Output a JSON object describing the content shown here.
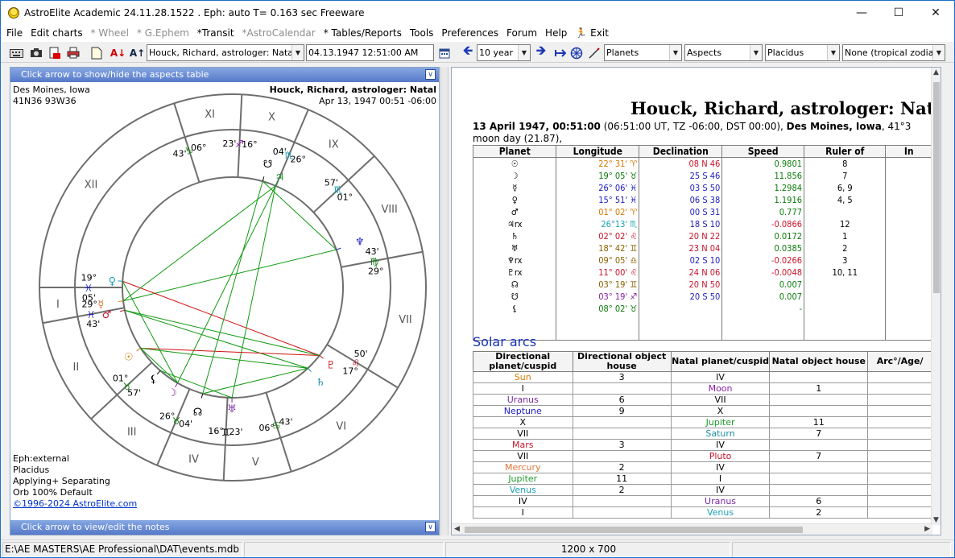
{
  "window": {
    "title": "AstroElite Academic 24.11.28.1522 . Eph: auto T= 0.163 sec Freeware"
  },
  "menu": [
    {
      "label": "File",
      "enabled": true
    },
    {
      "label": "Edit charts",
      "enabled": true
    },
    {
      "label": "* Wheel",
      "enabled": false
    },
    {
      "label": "* G.Ephem",
      "enabled": false
    },
    {
      "label": "*Transit",
      "enabled": true
    },
    {
      "label": "*AstroCalendar",
      "enabled": false
    },
    {
      "label": "* Tables/Reports",
      "enabled": true
    },
    {
      "label": "Tools",
      "enabled": true
    },
    {
      "label": "Preferences",
      "enabled": true
    },
    {
      "label": "Forum",
      "enabled": true
    },
    {
      "label": "Help",
      "enabled": true
    },
    {
      "label": "Exit",
      "enabled": true,
      "icon": "running-man-icon"
    }
  ],
  "toolbar": {
    "chart_name": "Houck, Richard, astrologer: Nata",
    "datetime": "04.13.1947   12:51:00 AM",
    "step": "10 year",
    "planets": "Planets",
    "aspects": "Aspects",
    "house_system": "Placidus",
    "zodiac": "None (tropical zodiac)"
  },
  "left": {
    "top_bar": "Click arrow to show/hide the aspects table",
    "bottom_bar": "Click arrow to view/edit the notes",
    "location": "Des Moines, Iowa",
    "coords": "41N36 93W36",
    "chart_title": "Houck, Richard, astrologer: Natal",
    "chart_date": "Apr 13, 1947 00:51 -06:00",
    "eph": "Eph:external",
    "house": "Placidus",
    "applying": "Applying+ Separating",
    "orb": "Orb 100% Default",
    "copyright": "©1996-2024 AstroElite.com"
  },
  "wheel": {
    "houses": [
      {
        "numeral": "I",
        "cusp_deg": 19,
        "cusp_min": "05'",
        "sign": "Pisces"
      },
      {
        "numeral": "II",
        "cusp_deg": 29,
        "cusp_min": "43'",
        "sign": "Pisces"
      },
      {
        "numeral": "III",
        "cusp_deg": 1,
        "cusp_min": "57'",
        "sign": "Taurus"
      },
      {
        "numeral": "IV",
        "cusp_deg": 26,
        "cusp_min": "04'",
        "sign": "Taurus"
      },
      {
        "numeral": "V",
        "cusp_deg": 16,
        "cusp_min": "23'",
        "sign": "Gemini"
      },
      {
        "numeral": "VI",
        "cusp_deg": 6,
        "cusp_min": "43'",
        "sign": "Cancer"
      },
      {
        "numeral": "VII",
        "cusp_deg": 17,
        "cusp_min": "50'",
        "sign": "Leo"
      },
      {
        "numeral": "VIII",
        "cusp_deg": 29,
        "cusp_min": "43'",
        "sign": "Virgo"
      },
      {
        "numeral": "IX",
        "cusp_deg": 1,
        "cusp_min": "57'",
        "sign": "Scorpio"
      },
      {
        "numeral": "X",
        "cusp_deg": 26,
        "cusp_min": "04'",
        "sign": "Scorpio"
      },
      {
        "numeral": "XI",
        "cusp_deg": 16,
        "cusp_min": "23'",
        "sign": "Sagittarius"
      },
      {
        "numeral": "XII",
        "cusp_deg": 6,
        "cusp_min": "43'",
        "sign": "Capricorn"
      }
    ],
    "planets": [
      {
        "name": "Sun",
        "glyph": "☉",
        "deg": "22°",
        "min": "31'",
        "sign": "Aries",
        "color": "#d67a00"
      },
      {
        "name": "Moon",
        "glyph": "☽",
        "deg": "19°",
        "min": "05'",
        "sign": "Taurus",
        "color": "#8a1fa6"
      },
      {
        "name": "Mercury",
        "glyph": "☿",
        "deg": "26°",
        "min": "06'",
        "sign": "Pisces",
        "color": "#e0743a"
      },
      {
        "name": "Venus",
        "glyph": "♀",
        "deg": "15°",
        "min": "51'",
        "sign": "Pisces",
        "color": "#1aa0b5"
      },
      {
        "name": "Mars",
        "glyph": "♂",
        "deg": "01°",
        "min": "02'",
        "sign": "Aries",
        "color": "#c8142a"
      },
      {
        "name": "Jupiter",
        "glyph": "♃",
        "deg": "26°",
        "min": "13'",
        "sign": "Scorpio",
        "color": "#1b9a2a"
      },
      {
        "name": "Saturn",
        "glyph": "♄",
        "deg": "02°",
        "min": "02'",
        "sign": "Leo",
        "color": "#1f8ea8"
      },
      {
        "name": "Uranus",
        "glyph": "♅",
        "deg": "18°",
        "min": "42'",
        "sign": "Gemini",
        "color": "#7a2aa8"
      },
      {
        "name": "Neptune",
        "glyph": "♆",
        "deg": "09°",
        "min": "05'",
        "sign": "Libra",
        "color": "#2020c0"
      },
      {
        "name": "Pluto",
        "glyph": "♇",
        "deg": "11°",
        "min": "00'",
        "sign": "Leo",
        "color": "#c81e1e"
      },
      {
        "name": "Node",
        "glyph": "☊",
        "deg": "03°",
        "min": "19'",
        "sign": "Gemini",
        "color": "#000"
      },
      {
        "name": "South Node",
        "glyph": "☋",
        "deg": "03°",
        "min": "19'",
        "sign": "Sagittarius",
        "color": "#000"
      },
      {
        "name": "Lilith",
        "glyph": "⚸",
        "deg": "08°",
        "min": "02'",
        "sign": "Taurus",
        "color": "#000"
      }
    ],
    "colors": {
      "green": "#119911",
      "red": "#cc1111",
      "ring": "#6e6e6e"
    }
  },
  "report": {
    "title": "Houck, Richard, astrologer: Natal",
    "date_bold": "13 April 1947, 00:51:00",
    "date_rest": "  (06:51:00 UT, TZ -06:00, DST  00:00), ",
    "place_bold": "Des Moines, Iowa",
    "place_rest": ", 41°3",
    "moon_day": "moon day (21.87),",
    "planet_headers": [
      "Planet",
      "Longitude",
      "Declination",
      "Speed",
      "Ruler of",
      "In"
    ],
    "planet_rows": [
      {
        "glyph": "☉",
        "rx": "",
        "lon": "22° 31' ♈",
        "lon_color": "#d67a00",
        "dec": "08 N 46",
        "dec_color": "#c8142a",
        "speed": "0.9801",
        "speed_color": "#0a7a0a",
        "ruler": "8"
      },
      {
        "glyph": "☽",
        "rx": "",
        "lon": "19° 05' ♉",
        "lon_color": "#0a7a0a",
        "dec": "25 S 46",
        "dec_color": "#2020c0",
        "speed": "11.856",
        "speed_color": "#0a7a0a",
        "ruler": "7"
      },
      {
        "glyph": "☿",
        "rx": "",
        "lon": "26° 06' ♓",
        "lon_color": "#2020c0",
        "dec": "03 S 50",
        "dec_color": "#2020c0",
        "speed": "1.2984",
        "speed_color": "#0a7a0a",
        "ruler": "6, 9"
      },
      {
        "glyph": "♀",
        "rx": "",
        "lon": "15° 51' ♓",
        "lon_color": "#2020c0",
        "dec": "06 S 38",
        "dec_color": "#2020c0",
        "speed": "1.1916",
        "speed_color": "#0a7a0a",
        "ruler": "4, 5"
      },
      {
        "glyph": "♂",
        "rx": "",
        "lon": "01° 02' ♈",
        "lon_color": "#d67a00",
        "dec": "00 S 31",
        "dec_color": "#2020c0",
        "speed": "0.777",
        "speed_color": "#0a7a0a",
        "ruler": ""
      },
      {
        "glyph": "♃",
        "rx": "rx",
        "lon": "26°13' ♏",
        "lon_color": "#1aa0b5",
        "dec": "18 S 10",
        "dec_color": "#2020c0",
        "speed": "-0.0866",
        "speed_color": "#c8142a",
        "ruler": "12"
      },
      {
        "glyph": "♄",
        "rx": "",
        "lon": "02° 02' ♌",
        "lon_color": "#c8142a",
        "dec": "20 N 22",
        "dec_color": "#c8142a",
        "speed": "0.0172",
        "speed_color": "#0a7a0a",
        "ruler": "1"
      },
      {
        "glyph": "♅",
        "rx": "",
        "lon": "18° 42' ♊",
        "lon_color": "#8a6000",
        "dec": "23 N 04",
        "dec_color": "#c8142a",
        "speed": "0.0385",
        "speed_color": "#0a7a0a",
        "ruler": "2"
      },
      {
        "glyph": "♆",
        "rx": "rx",
        "lon": "09° 05' ♎",
        "lon_color": "#8a6000",
        "dec": "02 S 10",
        "dec_color": "#2020c0",
        "speed": "-0.0266",
        "speed_color": "#c8142a",
        "ruler": "3"
      },
      {
        "glyph": "♇",
        "rx": "rx",
        "lon": "11° 00' ♌",
        "lon_color": "#c8142a",
        "dec": "24 N 06",
        "dec_color": "#c8142a",
        "speed": "-0.0048",
        "speed_color": "#c8142a",
        "ruler": "10, 11"
      },
      {
        "glyph": "☊",
        "rx": "",
        "lon": "03° 19' ♊",
        "lon_color": "#8a6000",
        "dec": "20 N 50",
        "dec_color": "#c8142a",
        "speed": "0.007",
        "speed_color": "#0a7a0a",
        "ruler": ""
      },
      {
        "glyph": "☋",
        "rx": "",
        "lon": "03° 19' ♐",
        "lon_color": "#8a1fa6",
        "dec": "20 S 50",
        "dec_color": "#2020c0",
        "speed": "0.007",
        "speed_color": "#0a7a0a",
        "ruler": ""
      },
      {
        "glyph": "⚸",
        "rx": "",
        "lon": "08° 02' ♉",
        "lon_color": "#0a7a0a",
        "dec": "",
        "dec_color": "#000",
        "speed": "-",
        "speed_color": "#0a7a0a",
        "ruler": ""
      }
    ],
    "solar_arcs_heading": "Solar arcs",
    "solar_headers": [
      "Directional planet/cuspid",
      "Directional object house",
      "Natal planet/cuspid",
      "Natal object house",
      "Arc°/Age/"
    ],
    "solar_rows": [
      {
        "dir": "Sun",
        "dir_color": "#d67a00",
        "dir_house": "3",
        "natal": "IV",
        "natal_color": "#000",
        "natal_house": ""
      },
      {
        "dir": "I",
        "dir_color": "#000",
        "dir_house": "",
        "natal": "Moon",
        "natal_color": "#8a1fa6",
        "natal_house": "1"
      },
      {
        "dir": "Uranus",
        "dir_color": "#7a2aa8",
        "dir_house": "6",
        "natal": "VII",
        "natal_color": "#000",
        "natal_house": ""
      },
      {
        "dir": "Neptune",
        "dir_color": "#2020c0",
        "dir_house": "9",
        "natal": "X",
        "natal_color": "#000",
        "natal_house": ""
      },
      {
        "dir": "X",
        "dir_color": "#000",
        "dir_house": "",
        "natal": "Jupiter",
        "natal_color": "#1b9a2a",
        "natal_house": "11"
      },
      {
        "dir": "VII",
        "dir_color": "#000",
        "dir_house": "",
        "natal": "Saturn",
        "natal_color": "#1f8ea8",
        "natal_house": "7"
      },
      {
        "dir": "Mars",
        "dir_color": "#c8142a",
        "dir_house": "3",
        "natal": "IV",
        "natal_color": "#000",
        "natal_house": ""
      },
      {
        "dir": "VII",
        "dir_color": "#000",
        "dir_house": "",
        "natal": "Pluto",
        "natal_color": "#c8142a",
        "natal_house": "7"
      },
      {
        "dir": "Mercury",
        "dir_color": "#e0743a",
        "dir_house": "2",
        "natal": "IV",
        "natal_color": "#000",
        "natal_house": ""
      },
      {
        "dir": "Jupiter",
        "dir_color": "#1b9a2a",
        "dir_house": "11",
        "natal": "I",
        "natal_color": "#000",
        "natal_house": ""
      },
      {
        "dir": "Venus",
        "dir_color": "#1aa0b5",
        "dir_house": "2",
        "natal": "IV",
        "natal_color": "#000",
        "natal_house": ""
      },
      {
        "dir": "IV",
        "dir_color": "#000",
        "dir_house": "",
        "natal": "Uranus",
        "natal_color": "#7a2aa8",
        "natal_house": "6"
      },
      {
        "dir": "I",
        "dir_color": "#000",
        "dir_house": "",
        "natal": "Venus",
        "natal_color": "#1aa0b5",
        "natal_house": "2"
      }
    ]
  },
  "status": {
    "path": "E:\\AE MASTERS\\AE Professional\\DAT\\events.mdb",
    "resolution": "1200 x 700"
  }
}
